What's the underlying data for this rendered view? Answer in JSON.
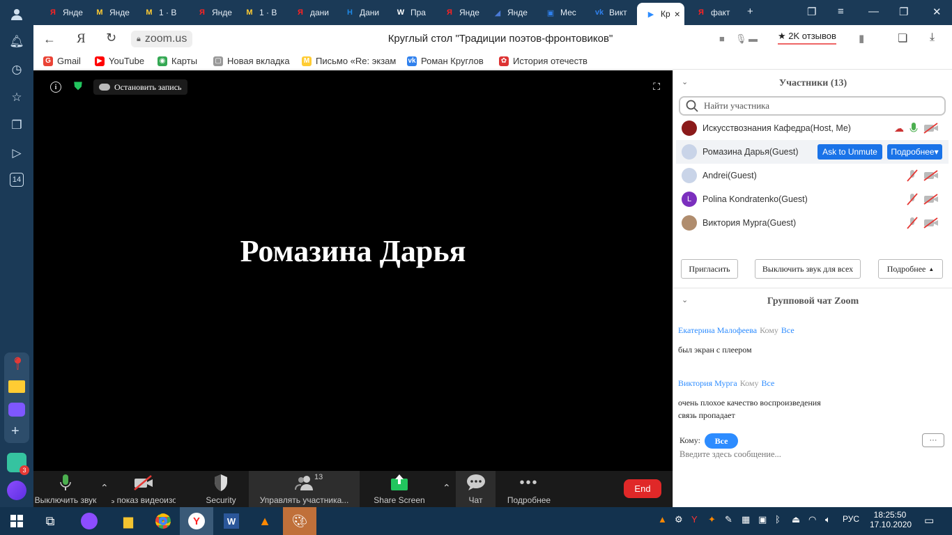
{
  "tabs": [
    {
      "label": "Янде",
      "favicon": "Я",
      "fav_color": "#f22"
    },
    {
      "label": "Янде",
      "favicon": "M",
      "fav_color": "#fc3"
    },
    {
      "label": "1 · В",
      "favicon": "M",
      "fav_color": "#fc3"
    },
    {
      "label": "Янде",
      "favicon": "Я",
      "fav_color": "#f22"
    },
    {
      "label": "1 · В",
      "favicon": "M",
      "fav_color": "#fc3"
    },
    {
      "label": "дани",
      "favicon": "Я",
      "fav_color": "#f22"
    },
    {
      "label": "Дани",
      "favicon": "H",
      "fav_color": "#1e88e5"
    },
    {
      "label": "Пра",
      "favicon": "W",
      "fav_color": "#fff"
    },
    {
      "label": "Янде",
      "favicon": "Я",
      "fav_color": "#f22"
    },
    {
      "label": "Янде",
      "favicon": "◢",
      "fav_color": "#4a7ad6"
    },
    {
      "label": "Мес",
      "favicon": "▣",
      "fav_color": "#2f80ed"
    },
    {
      "label": "Викт",
      "favicon": "vk",
      "fav_color": "#2f80ed"
    },
    {
      "label": "Кр",
      "favicon": "▶",
      "fav_color": "#2d8cff",
      "active": true
    },
    {
      "label": "факт",
      "favicon": "Я",
      "fav_color": "#f22"
    }
  ],
  "address": {
    "url": "zoom.us",
    "title": "Круглый стол \"Традиции поэтов-фронтовиков\"",
    "reviews": "2K отзывов"
  },
  "bookmarks": [
    {
      "label": "Gmail",
      "icon": "G",
      "color": "#ea4335"
    },
    {
      "label": "YouTube",
      "icon": "▶",
      "color": "#f00"
    },
    {
      "label": "Карты",
      "icon": "◉",
      "color": "#34a853"
    },
    {
      "label": "Новая вкладка",
      "icon": "▢",
      "color": "#999"
    },
    {
      "label": "Письмо «Re: экзам",
      "icon": "M",
      "color": "#fc3"
    },
    {
      "label": "Роман Круглов",
      "icon": "vk",
      "color": "#2f80ed"
    },
    {
      "label": "История отечеств",
      "icon": "✿",
      "color": "#d33"
    }
  ],
  "meeting": {
    "record_label": "Остановить запись",
    "speaker_name": "Ромазина Дарья"
  },
  "toolbar": {
    "mute": "Выключить звук",
    "video": "ь показ видеоизо",
    "security": "Security",
    "participants": "Управлять участника...",
    "participants_count": "13",
    "share": "Share Screen",
    "chat": "Чат",
    "more": "Подробнее",
    "end": "End"
  },
  "participants_panel": {
    "title": "Участники (13)",
    "search_placeholder": "Найти участника",
    "list": [
      {
        "name": "Искусствознания Кафедра(Host, Me)",
        "avatar": "img",
        "av_color": "#8b1a1a"
      },
      {
        "name": "Ромазина Дарья(Guest)",
        "avatar": "",
        "av_color": "#c9d4e8"
      },
      {
        "name": "Andrei(Guest)",
        "avatar": "",
        "av_color": "#c9d4e8"
      },
      {
        "name": "Polina Kondratenko(Guest)",
        "avatar": "L",
        "av_color": "#7b2fbe"
      },
      {
        "name": "Виктория Мурга(Guest)",
        "avatar": "img",
        "av_color": "#b08d6e"
      }
    ],
    "ask_unmute": "Ask to Unmute",
    "more_btn": "Подробнее",
    "invite": "Пригласить",
    "mute_all": "Выключить звук для всех",
    "more_bottom": "Подробнее"
  },
  "chat": {
    "title": "Групповой чат Zoom",
    "messages": [
      {
        "sender": "Екатерина Малофеева",
        "to_label": "Кому",
        "to": "Все",
        "lines": [
          "был экран с плеером"
        ]
      },
      {
        "sender": "Виктория Мурга",
        "to_label": "Кому",
        "to": "Все",
        "lines": [
          "очень плохое качество воспроизведения",
          "связь пропадает"
        ]
      }
    ],
    "to_prefix": "Кому:",
    "recipient": "Все",
    "more": "···",
    "input_placeholder": "Введите здесь сообщение..."
  },
  "taskbar": {
    "time": "18:25:50",
    "date": "17.10.2020",
    "lang": "РУС"
  },
  "sidebar": {
    "badge": "3",
    "counter": "14"
  }
}
